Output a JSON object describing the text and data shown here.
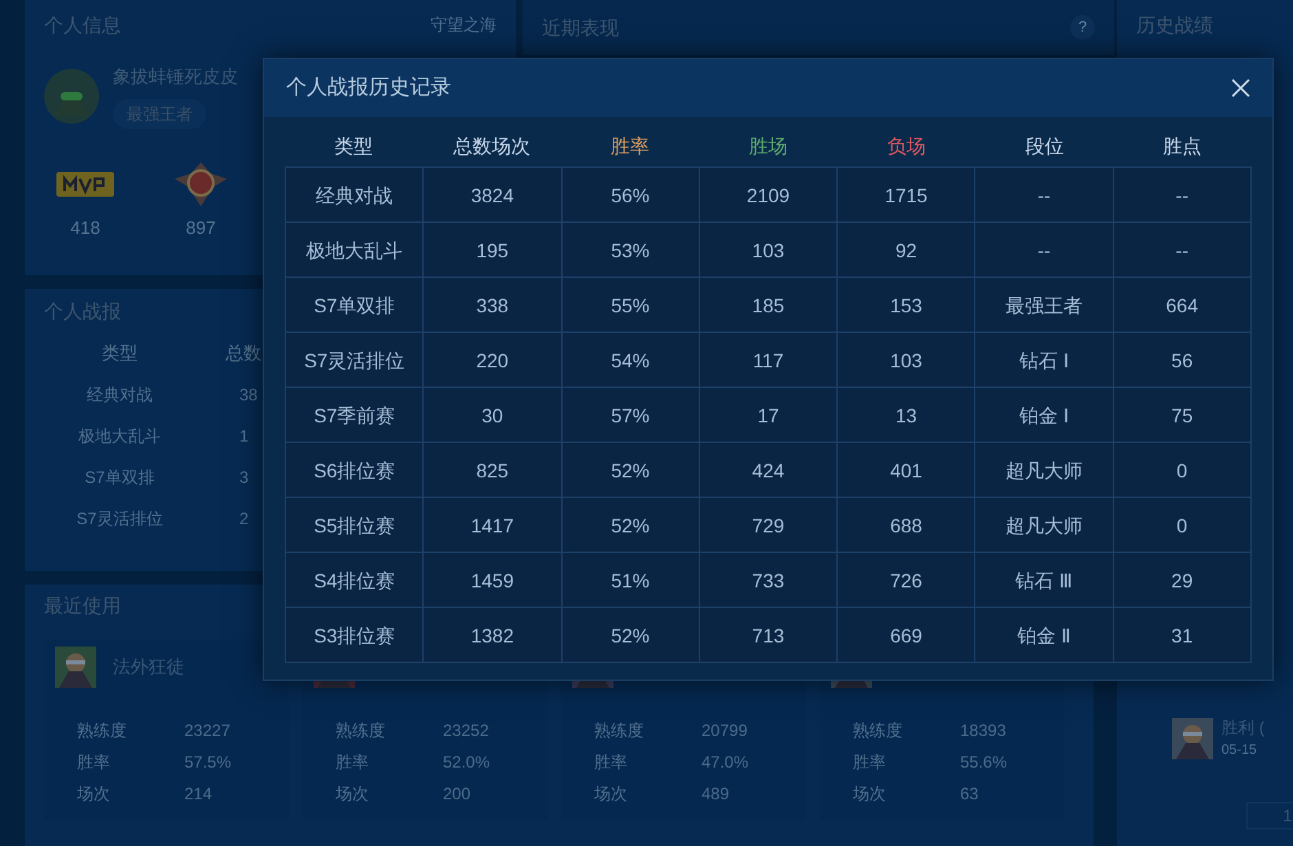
{
  "profile": {
    "title": "个人信息",
    "server": "守望之海",
    "name": "象拔蚌锤死皮皮",
    "tag": "最强王者",
    "stats": [
      {
        "kind": "mvp",
        "value": "418"
      },
      {
        "kind": "emblem",
        "value": "897"
      }
    ]
  },
  "recent": {
    "title": "近期表现",
    "help": "?"
  },
  "report": {
    "title": "个人战报",
    "columns": [
      "类型",
      "总数"
    ],
    "rows": [
      [
        "经典对战",
        "38"
      ],
      [
        "极地大乱斗",
        "1"
      ],
      [
        "S7单双排",
        "3"
      ],
      [
        "S7灵活排位",
        "2"
      ]
    ]
  },
  "used": {
    "title": "最近使用",
    "champions": [
      {
        "name": "法外狂徒",
        "stats": [
          [
            "熟练度",
            "23227"
          ],
          [
            "胜率",
            "57.5%"
          ],
          [
            "场次",
            "214"
          ]
        ]
      },
      {
        "stats": [
          [
            "熟练度",
            "23252"
          ],
          [
            "胜率",
            "52.0%"
          ],
          [
            "场次",
            "200"
          ]
        ]
      },
      {
        "stats": [
          [
            "熟练度",
            "20799"
          ],
          [
            "胜率",
            "47.0%"
          ],
          [
            "场次",
            "489"
          ]
        ]
      },
      {
        "stats": [
          [
            "熟练度",
            "18393"
          ],
          [
            "胜率",
            "55.6%"
          ],
          [
            "场次",
            "63"
          ]
        ]
      }
    ]
  },
  "history": {
    "title": "历史战绩",
    "match": {
      "result": "胜利 (",
      "date": "05-15"
    },
    "page": "1"
  },
  "dialog": {
    "title": "个人战报历史记录",
    "columns": [
      {
        "label": "类型",
        "color": "#c9d8ea"
      },
      {
        "label": "总数场次",
        "color": "#c9d8ea"
      },
      {
        "label": "胜率",
        "color": "#e0a060"
      },
      {
        "label": "胜场",
        "color": "#5fae6e"
      },
      {
        "label": "负场",
        "color": "#e0585e"
      },
      {
        "label": "段位",
        "color": "#c9d8ea"
      },
      {
        "label": "胜点",
        "color": "#c9d8ea"
      }
    ],
    "rows": [
      [
        "经典对战",
        "3824",
        "56%",
        "2109",
        "1715",
        "--",
        "--"
      ],
      [
        "极地大乱斗",
        "195",
        "53%",
        "103",
        "92",
        "--",
        "--"
      ],
      [
        "S7单双排",
        "338",
        "55%",
        "185",
        "153",
        "最强王者",
        "664"
      ],
      [
        "S7灵活排位",
        "220",
        "54%",
        "117",
        "103",
        "钻石 Ⅰ",
        "56"
      ],
      [
        "S7季前赛",
        "30",
        "57%",
        "17",
        "13",
        "铂金 Ⅰ",
        "75"
      ],
      [
        "S6排位赛",
        "825",
        "52%",
        "424",
        "401",
        "超凡大师",
        "0"
      ],
      [
        "S5排位赛",
        "1417",
        "52%",
        "729",
        "688",
        "超凡大师",
        "0"
      ],
      [
        "S4排位赛",
        "1459",
        "51%",
        "733",
        "726",
        "钻石 Ⅲ",
        "29"
      ],
      [
        "S3排位赛",
        "1382",
        "52%",
        "713",
        "669",
        "铂金 Ⅱ",
        "31"
      ]
    ]
  }
}
